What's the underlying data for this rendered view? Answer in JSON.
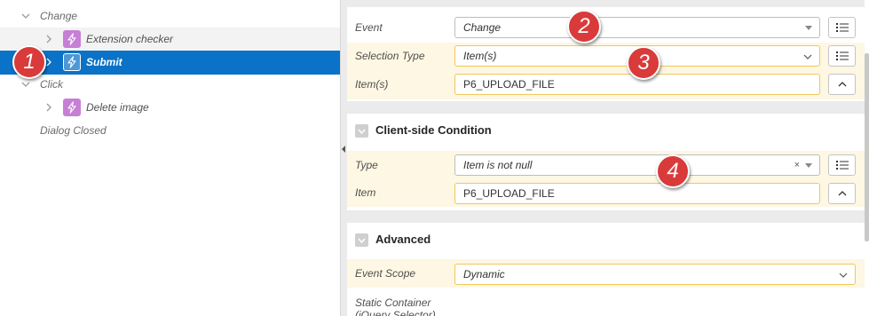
{
  "tree": {
    "change_label": "Change",
    "extension_checker_label": "Extension checker",
    "submit_label": "Submit",
    "click_label": "Click",
    "delete_image_label": "Delete image",
    "dialog_closed_label": "Dialog Closed"
  },
  "when": {
    "event_label": "Event",
    "event_value": "Change",
    "selection_type_label": "Selection Type",
    "selection_type_value": "Item(s)",
    "items_label": "Item(s)",
    "items_value": "P6_UPLOAD_FILE"
  },
  "client_condition": {
    "title": "Client-side Condition",
    "type_label": "Type",
    "type_value": "Item is not null",
    "clear_glyph": "×",
    "item_label": "Item",
    "item_value": "P6_UPLOAD_FILE"
  },
  "advanced": {
    "title": "Advanced",
    "event_scope_label": "Event Scope",
    "event_scope_value": "Dynamic",
    "static_container_label_1": "Static Container",
    "static_container_label_2": "(jQuery Selector)"
  },
  "annotations": [
    "1",
    "2",
    "3",
    "4"
  ],
  "colors": {
    "selected_row": "#0a72c7",
    "dynamic_action_icon": "#c77fd6",
    "highlight_row": "#fdf7e3",
    "badge": "#d93a3a"
  },
  "icons": {
    "tree_item": "lightning-bolt-icon",
    "expand": "chevron-right-icon",
    "collapse": "chevron-down-icon",
    "list_picker": "list-icon",
    "collapse_field": "chevron-up-icon"
  }
}
